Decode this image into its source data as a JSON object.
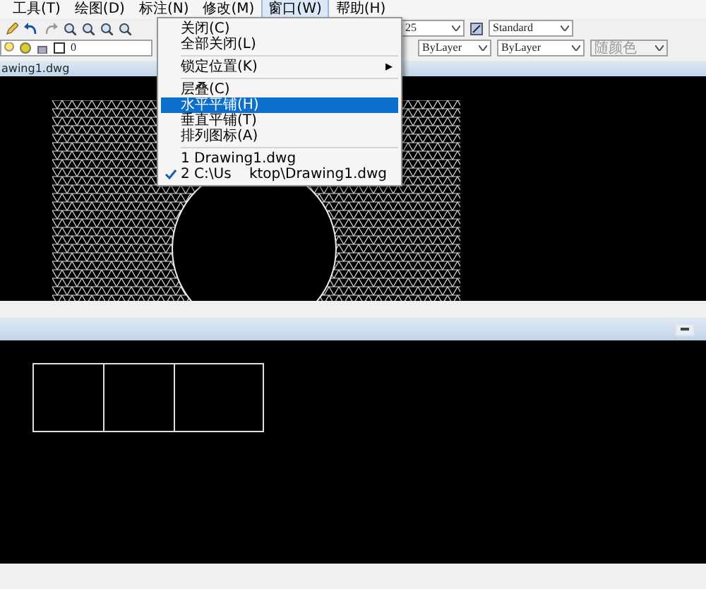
{
  "menu_bar": [
    {
      "label": "工具(T)",
      "selected": false
    },
    {
      "label": "绘图(D)",
      "selected": false
    },
    {
      "label": "标注(N)",
      "selected": false
    },
    {
      "label": "修改(M)",
      "selected": false
    },
    {
      "label": "窗口(W)",
      "selected": true
    },
    {
      "label": "帮助(H)",
      "selected": false
    }
  ],
  "toolbar": {
    "layer_value": "0",
    "row_1_combos": [
      {
        "value": "25",
        "disabled": false
      },
      {
        "value": "Standard",
        "disabled": false
      }
    ],
    "row_2_combos": [
      {
        "value": "ByLayer",
        "disabled": false
      },
      {
        "value": "ByLayer",
        "disabled": false
      },
      {
        "value": "随颜色",
        "disabled": true
      }
    ]
  },
  "window_menu": {
    "groups": [
      [
        {
          "label": "关闭(C)",
          "selected": false,
          "checked": false
        },
        {
          "label": "全部关闭(L)",
          "selected": false,
          "checked": false
        }
      ],
      [
        {
          "label": "锁定位置(K)",
          "selected": false,
          "checked": false,
          "arrow": "▸"
        }
      ],
      [
        {
          "label": "层叠(C)",
          "selected": false,
          "checked": false
        },
        {
          "label": "水平平铺(H)",
          "selected": true,
          "checked": false
        },
        {
          "label": "垂直平铺(T)",
          "selected": false,
          "checked": false
        },
        {
          "label": "排列图标(A)",
          "selected": false,
          "checked": false
        }
      ],
      [
        {
          "label": "1 Drawing1.dwg",
          "selected": false,
          "checked": false
        },
        {
          "label": "2 C:\\Us",
          "label_end": "ktop\\Drawing1.dwg",
          "selected": false,
          "checked": true
        }
      ]
    ]
  },
  "top_window": {
    "title": "awing1.dwg"
  }
}
